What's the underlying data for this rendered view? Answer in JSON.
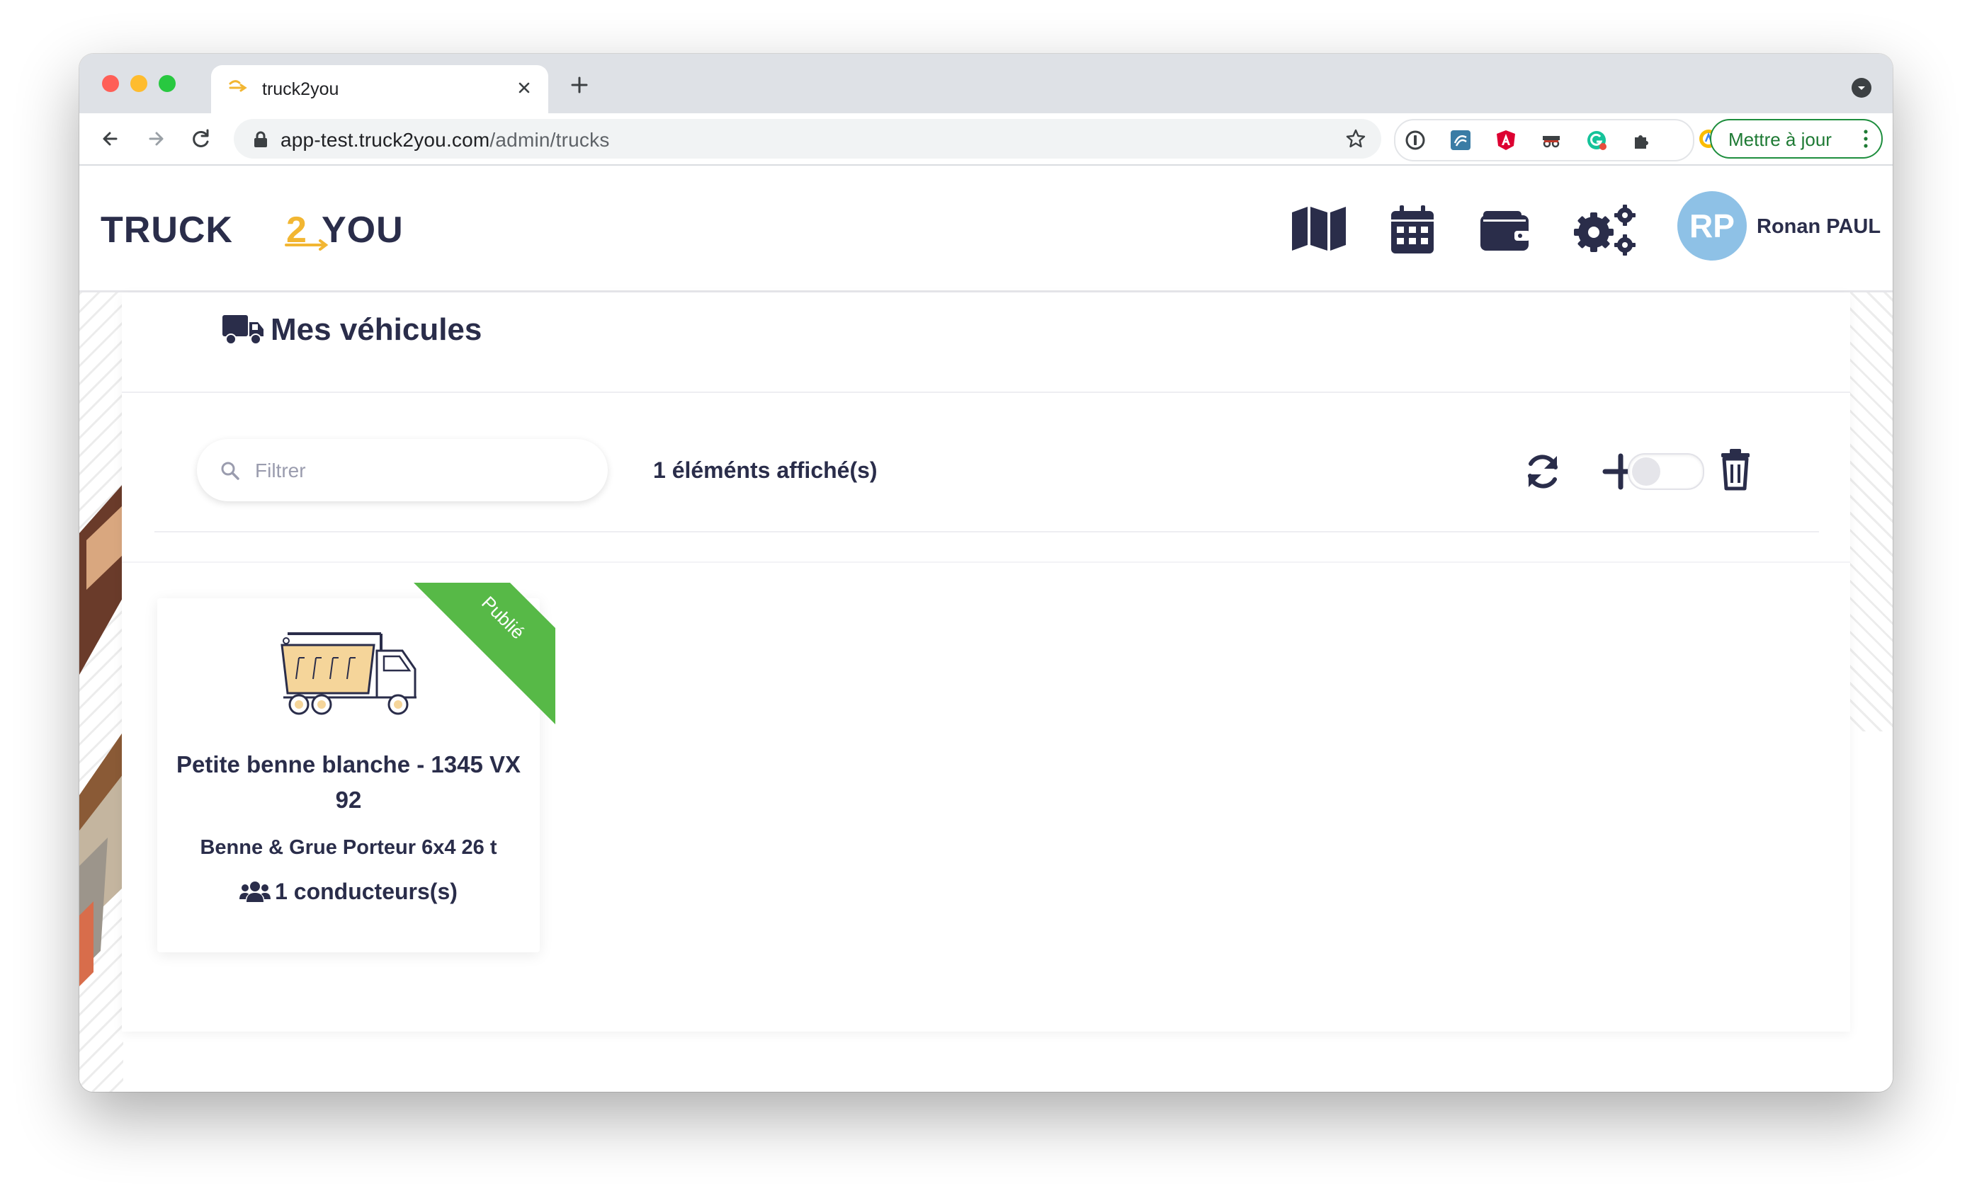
{
  "browser": {
    "tab_title": "truck2you",
    "url_domain": "app-test.truck2you.com",
    "url_path": "/admin/trucks",
    "update_button_label": "Mettre à jour",
    "close_color": "#ff5f57",
    "minimize_color": "#febc2e",
    "maximize_color": "#28c840"
  },
  "app": {
    "logo_text_left": "TRUCK",
    "logo_text_mid": "2",
    "logo_text_right": "YOU",
    "accent_color": "#f2b632",
    "nav_icons": [
      "map-icon",
      "calendar-icon",
      "wallet-icon",
      "settings-gears-icon"
    ],
    "user": {
      "initials": "RP",
      "name": "Ronan PAUL"
    }
  },
  "page": {
    "title": "Mes véhicules",
    "filter_placeholder": "Filtrer",
    "count_text": "1 éléménts affiché(s)",
    "actions": [
      "refresh-icon",
      "add-icon",
      "toggle",
      "trash-icon"
    ]
  },
  "vehicles": [
    {
      "name": "Petite benne blanche - 1345 VX 92",
      "type": "Benne & Grue Porteur 6x4 26 t",
      "drivers": "1 conducteurs(s)",
      "status": "Publié",
      "status_color": "#57b947"
    }
  ]
}
